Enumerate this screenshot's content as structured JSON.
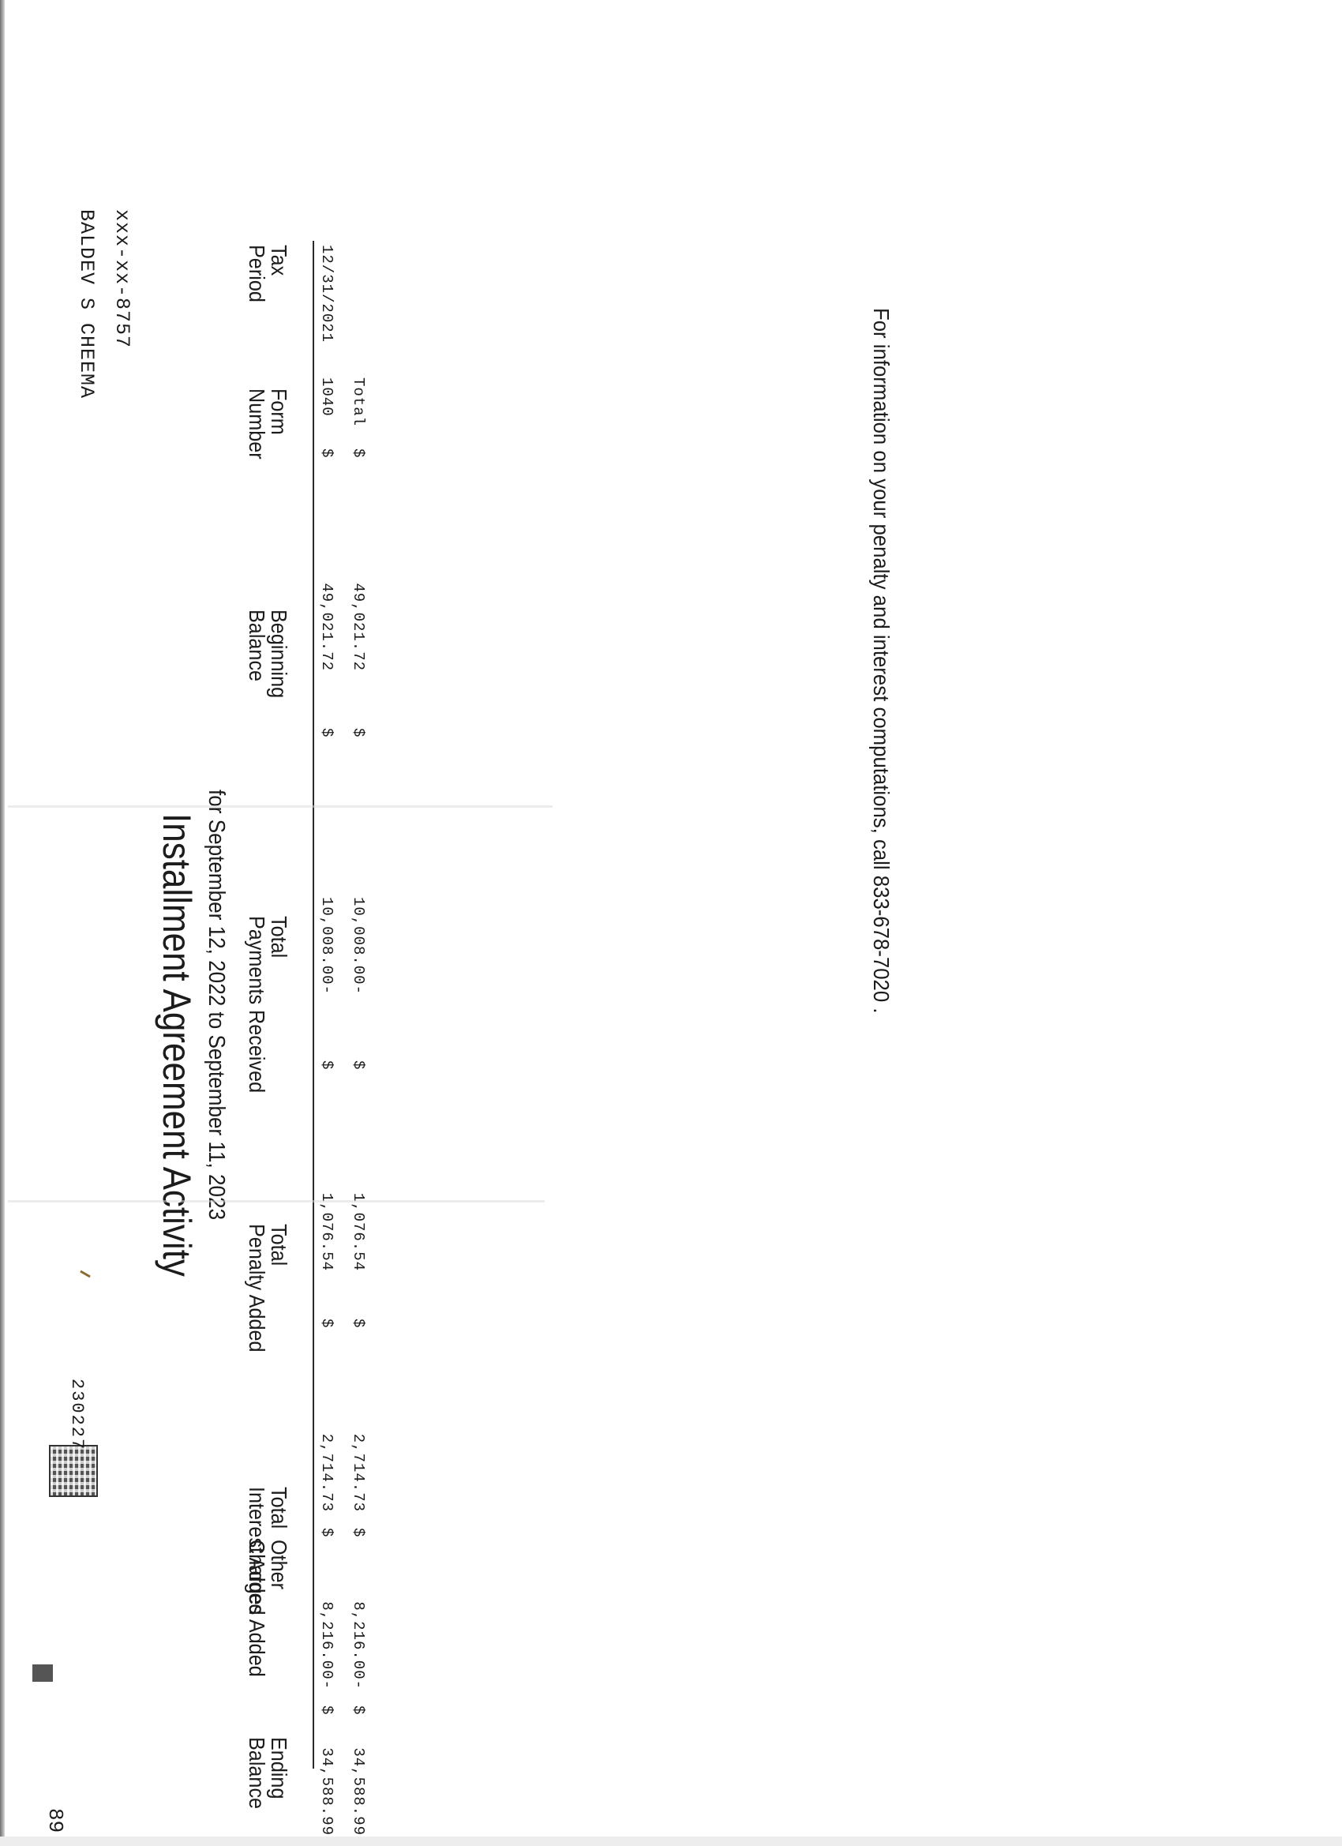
{
  "page_number": "89",
  "document_code": "230227",
  "taxpayer": {
    "name": "BALDEV S CHEEMA",
    "ssn": "xxx-xx-8757"
  },
  "title": "Installment Agreement Activity",
  "subtitle": "for September  12, 2022 to September 11, 2023",
  "columns": {
    "tax_period": [
      "Tax",
      "Period"
    ],
    "form_number": [
      "Form",
      "Number"
    ],
    "beginning_balance": [
      "Beginning",
      "Balance"
    ],
    "payments": [
      "Total",
      "Payments Received"
    ],
    "penalty": [
      "Total",
      "Penalty Added"
    ],
    "interest": [
      "Total",
      "Interest Added"
    ],
    "other": [
      "Other",
      "Charges Added"
    ],
    "ending_balance": [
      "Ending",
      "Balance"
    ]
  },
  "currency_symbol": "$",
  "rows": [
    {
      "tax_period": "12/31/2021",
      "form_number": "1040",
      "beginning_balance": "49,021.72",
      "payments": "10,008.00-",
      "penalty": "1,076.54",
      "interest": "2,714.73",
      "other": "8,216.00-",
      "ending_balance": "34,588.99"
    }
  ],
  "total_row": {
    "label": "Total",
    "beginning_balance": "49,021.72",
    "payments": "10,008.00-",
    "penalty": "1,076.54",
    "interest": "2,714.73",
    "other": "8,216.00-",
    "ending_balance": "34,588.99"
  },
  "footer": "For information on your penalty and interest computations, call 833-678-7020 ."
}
